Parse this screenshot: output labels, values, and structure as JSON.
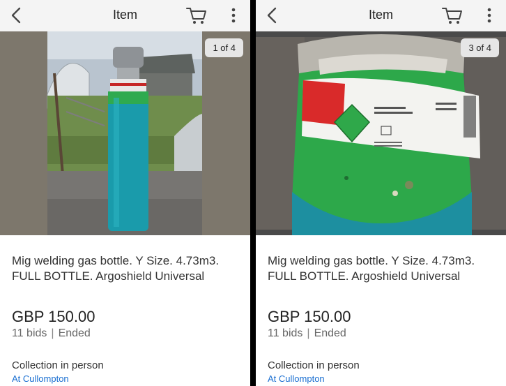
{
  "panels": [
    {
      "header_title": "Item",
      "photo_counter": "1 of 4",
      "item_title": "Mig welding gas bottle. Y Size. 4.73m3.  FULL BOTTLE. Argoshield Universal",
      "price": "GBP 150.00",
      "bids": "11 bids",
      "status": "Ended",
      "collection": "Collection in person",
      "location": "At Cullompton"
    },
    {
      "header_title": "Item",
      "photo_counter": "3 of 4",
      "item_title": "Mig welding gas bottle. Y Size. 4.73m3.  FULL BOTTLE. Argoshield Universal",
      "price": "GBP 150.00",
      "bids": "11 bids",
      "status": "Ended",
      "collection": "Collection in person",
      "location": "At Cullompton"
    }
  ],
  "icons": {
    "back": "chevron-left-icon",
    "cart": "shopping-cart-icon",
    "more": "more-vertical-icon"
  }
}
